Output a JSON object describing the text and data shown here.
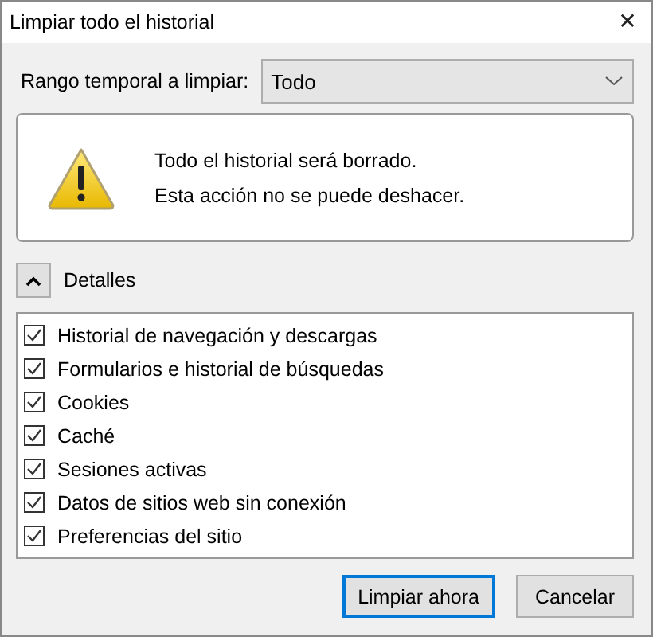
{
  "window": {
    "title": "Limpiar todo el historial",
    "close": "✕"
  },
  "time_range": {
    "label": "Rango temporal a limpiar:",
    "value": "Todo"
  },
  "warning": {
    "lines": [
      "Todo el historial será borrado.",
      "Esta acción no se puede deshacer."
    ]
  },
  "details": {
    "label": "Detalles",
    "expanded": true
  },
  "items": [
    {
      "label": "Historial de navegación y descargas",
      "checked": true
    },
    {
      "label": "Formularios e historial de búsquedas",
      "checked": true
    },
    {
      "label": "Cookies",
      "checked": true
    },
    {
      "label": "Caché",
      "checked": true
    },
    {
      "label": "Sesiones activas",
      "checked": true
    },
    {
      "label": "Datos de sitios web sin conexión",
      "checked": true
    },
    {
      "label": "Preferencias del sitio",
      "checked": true
    }
  ],
  "buttons": [
    {
      "label": "Limpiar ahora",
      "focused": true
    },
    {
      "label": "Cancelar",
      "focused": false
    }
  ]
}
